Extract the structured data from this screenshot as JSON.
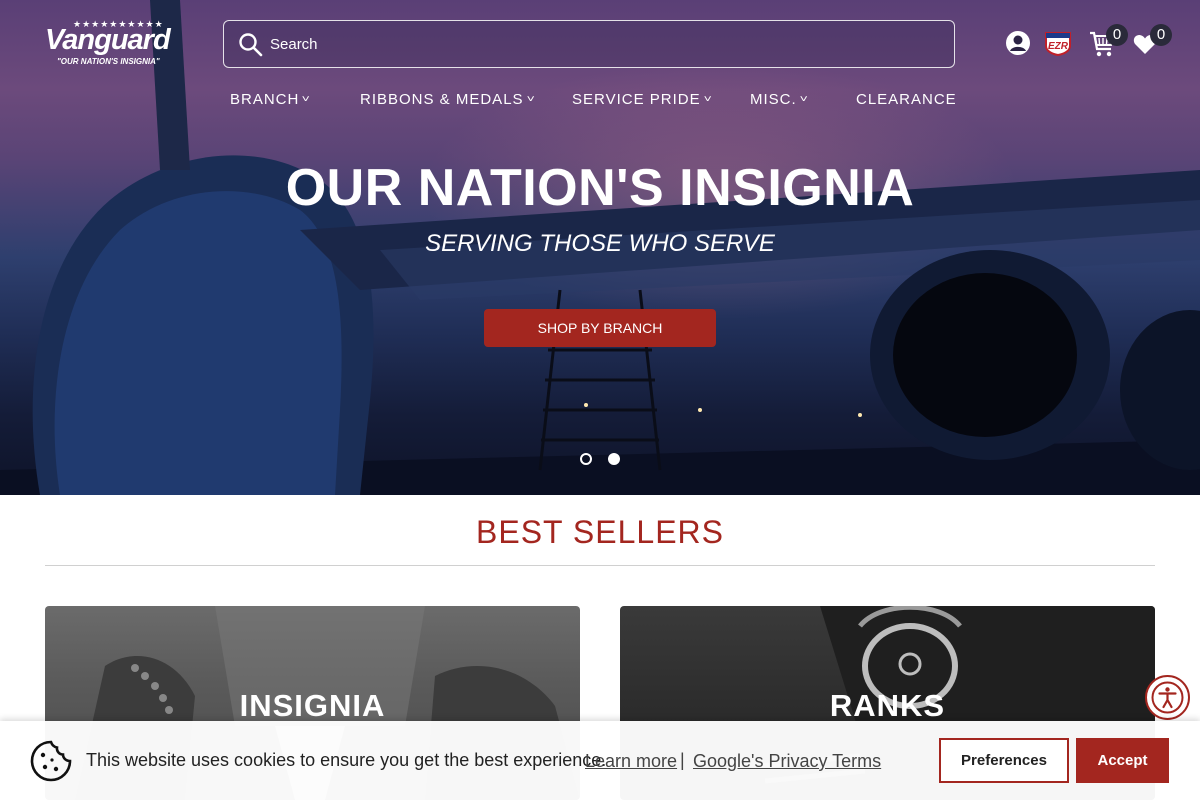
{
  "brand": {
    "logo_text": "Vanguard",
    "logo_tagline": "\"OUR NATION'S INSIGNIA\"",
    "logo_stars": "★★★★★★★★★★"
  },
  "search": {
    "placeholder": "Search",
    "value": ""
  },
  "header_icons": {
    "account": "account-icon",
    "ezr": "EZR",
    "cart_count": "0",
    "wishlist_count": "0"
  },
  "nav": [
    {
      "label": "BRANCH",
      "has_dropdown": true
    },
    {
      "label": "RIBBONS & MEDALS",
      "has_dropdown": true
    },
    {
      "label": "SERVICE PRIDE",
      "has_dropdown": true
    },
    {
      "label": "MISC.",
      "has_dropdown": true
    },
    {
      "label": "CLEARANCE",
      "has_dropdown": false
    }
  ],
  "hero": {
    "title": "OUR NATION'S INSIGNIA",
    "subtitle": "SERVING THOSE WHO SERVE",
    "cta_label": "SHOP BY BRANCH",
    "slide_count": 2,
    "active_slide": 2
  },
  "best_sellers": {
    "heading": "BEST SELLERS",
    "cards": [
      {
        "title": "INSIGNIA"
      },
      {
        "title": "RANKS"
      }
    ]
  },
  "cookie_banner": {
    "message": "This website uses cookies to ensure you get the best experience.",
    "learn_more": "Learn more",
    "separator": "|",
    "privacy_link": "Google's Privacy Terms",
    "preferences_label": "Preferences",
    "accept_label": "Accept"
  },
  "colors": {
    "accent": "#a3261f",
    "hero_top": "#5a3f76",
    "hero_bottom": "#0e1328"
  }
}
